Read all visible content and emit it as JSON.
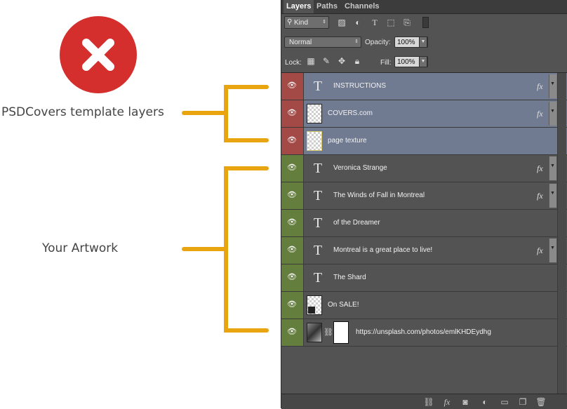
{
  "annotations": {
    "template_label": "PSDCovers template layers",
    "artwork_label": "Your Artwork",
    "bracket_color": "#e9a50f",
    "warning_color": "#d42f2d"
  },
  "panel": {
    "tabs": [
      "Layers",
      "Paths",
      "Channels"
    ],
    "filter": {
      "kind_label": "Kind"
    },
    "blend_mode": "Normal",
    "opacity_label": "Opacity:",
    "opacity_value": "100%",
    "lock_label": "Lock:",
    "fill_label": "Fill:",
    "fill_value": "100%",
    "layers": [
      {
        "name": "INSTRUCTIONS",
        "type": "text",
        "group": "template",
        "fx": "fx"
      },
      {
        "name": "COVERS.com",
        "type": "image",
        "group": "template",
        "fx": "fx"
      },
      {
        "name": "page texture",
        "type": "image",
        "group": "template",
        "fx": ""
      },
      {
        "name": "Veronica Strange",
        "type": "text",
        "group": "artwork",
        "fx": "fx"
      },
      {
        "name": "The Winds of Fall in Montreal",
        "type": "text",
        "group": "artwork",
        "fx": "fx"
      },
      {
        "name": "of the Dreamer",
        "type": "text",
        "group": "artwork",
        "fx": ""
      },
      {
        "name": "Montreal is a great place to live!",
        "type": "text",
        "group": "artwork",
        "fx": "fx"
      },
      {
        "name": "The Shard",
        "type": "text",
        "group": "artwork",
        "fx": ""
      },
      {
        "name": "On SALE!",
        "type": "image",
        "group": "artwork",
        "fx": ""
      },
      {
        "name": "https://unsplash.com/photos/emlKHDEydhg",
        "type": "masked-image",
        "group": "artwork",
        "fx": ""
      }
    ],
    "footer_icons": [
      "link-layers-icon",
      "fx-icon",
      "mask-icon",
      "adjustment-icon",
      "folder-icon",
      "new-layer-icon",
      "trash-icon"
    ]
  }
}
